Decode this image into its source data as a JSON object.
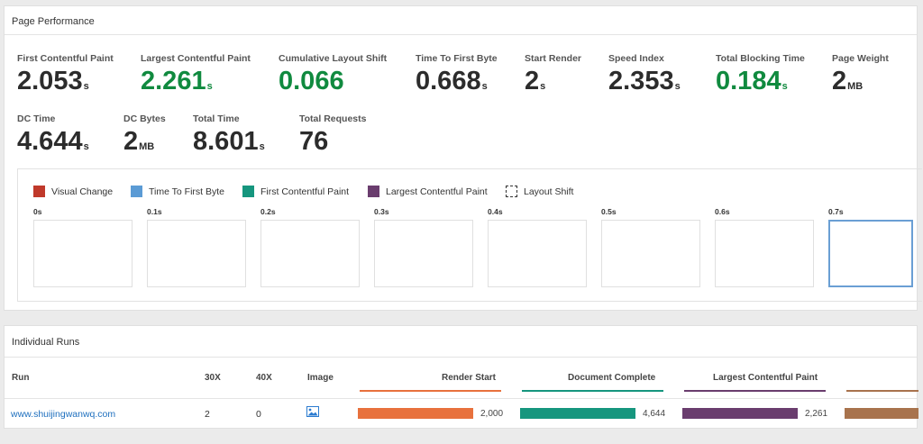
{
  "perf": {
    "title": "Page Performance",
    "metrics_row1": [
      {
        "label": "First Contentful Paint",
        "value": "2.053",
        "unit": "s",
        "good": false
      },
      {
        "label": "Largest Contentful Paint",
        "value": "2.261",
        "unit": "s",
        "good": true
      },
      {
        "label": "Cumulative Layout Shift",
        "value": "0.066",
        "unit": "",
        "good": true
      },
      {
        "label": "Time To First Byte",
        "value": "0.668",
        "unit": "s",
        "good": false
      },
      {
        "label": "Start Render",
        "value": "2",
        "unit": "s",
        "good": false
      },
      {
        "label": "Speed Index",
        "value": "2.353",
        "unit": "s",
        "good": false
      },
      {
        "label": "Total Blocking Time",
        "value": "0.184",
        "unit": "s",
        "good": true
      },
      {
        "label": "Page Weight",
        "value": "2",
        "unit": "MB",
        "good": false
      }
    ],
    "metrics_row2": [
      {
        "label": "DC Time",
        "value": "4.644",
        "unit": "s"
      },
      {
        "label": "DC Bytes",
        "value": "2",
        "unit": "MB"
      },
      {
        "label": "Total Time",
        "value": "8.601",
        "unit": "s"
      },
      {
        "label": "Total Requests",
        "value": "76",
        "unit": ""
      }
    ],
    "legend": [
      {
        "label": "Visual Change",
        "color": "#c0392b",
        "style": "solid"
      },
      {
        "label": "Time To First Byte",
        "color": "#5b9bd5",
        "style": "solid"
      },
      {
        "label": "First Contentful Paint",
        "color": "#16967e",
        "style": "solid"
      },
      {
        "label": "Largest Contentful Paint",
        "color": "#6a3d6e",
        "style": "solid"
      },
      {
        "label": "Layout Shift",
        "color": "#333333",
        "style": "dashed"
      }
    ],
    "frames": [
      "0s",
      "0.1s",
      "0.2s",
      "0.3s",
      "0.4s",
      "0.5s",
      "0.6s",
      "0.7s"
    ]
  },
  "runs": {
    "title": "Individual Runs",
    "headers": {
      "run": "Run",
      "x30": "30X",
      "x40": "40X",
      "image": "Image",
      "render_start": "Render Start",
      "document_complete": "Document Complete",
      "lcp": "Largest Contentful Paint"
    },
    "header_colors": {
      "render_start": "#e8713d",
      "document_complete": "#16967e",
      "lcp": "#6a3d6e",
      "extra": "#a8734d"
    },
    "rows": [
      {
        "run": "www.shuijingwanwq.com",
        "x30": "2",
        "x40": "0",
        "image_icon": "image-icon",
        "render_start": "2,000",
        "document_complete": "4,644",
        "lcp": "2,261"
      }
    ]
  }
}
